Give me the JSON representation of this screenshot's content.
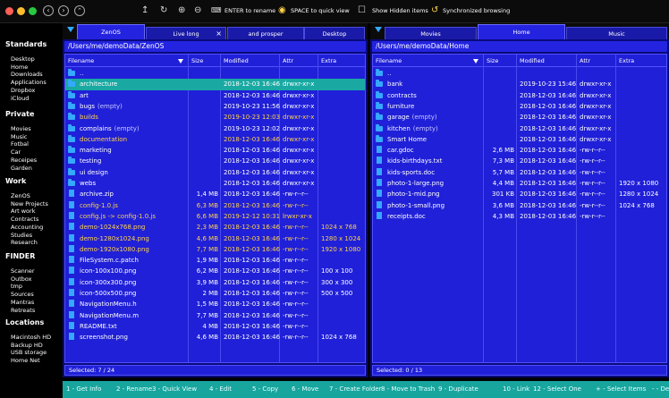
{
  "colors": {
    "accent": "#2323e0",
    "panel": "#2020d8",
    "selected": "#19a9a2",
    "highlight": "#ffd24a",
    "folder": "#35a8ff",
    "fkeybar": "#17a59e"
  },
  "toolbar": {
    "rename_hint": "ENTER to rename",
    "quickview_hint": "SPACE to quick view",
    "hidden_label": "Show Hidden items",
    "sync_label": "Synchronized browsing",
    "icons": [
      "back-icon",
      "forward-icon",
      "up-icon",
      "upload-icon",
      "refresh-icon",
      "add-icon",
      "remove-icon",
      "rename-icon",
      "eye-icon",
      "checkbox-icon",
      "sync-icon"
    ]
  },
  "sidebar": {
    "sections": [
      {
        "title": "Standards",
        "items": [
          "Desktop",
          "Home",
          "Downloads",
          "Applications",
          "Dropbox",
          "iCloud"
        ]
      },
      {
        "title": "Private",
        "items": [
          "Movies",
          "Music",
          "Fotbal",
          "Car",
          "Receipes",
          "Garden"
        ]
      },
      {
        "title": "Work",
        "items": [
          "ZenOS",
          "New Projects",
          "Art work",
          "Contracts",
          "Accounting",
          "Studies",
          "Research"
        ]
      },
      {
        "title": "FINDER",
        "items": [
          "Scanner",
          "Outbox",
          "tmp",
          "Sources",
          "Mantras",
          "Retreats"
        ]
      },
      {
        "title": "Locations",
        "items": [
          "Macintosh HD",
          "Backup HD",
          "USB storage",
          "Home Net"
        ]
      }
    ]
  },
  "left": {
    "tabs": [
      {
        "label": "ZenOS",
        "active": true
      },
      {
        "label": "Live long",
        "active": false,
        "closable": true
      },
      {
        "label": "and prosper",
        "active": false
      },
      {
        "label": "Desktop",
        "active": false
      }
    ],
    "path": "/Users/me/demoData/ZenOS",
    "columns": {
      "name": "Filename",
      "size": "Size",
      "modified": "Modified",
      "attr": "Attr",
      "extra": "Extra"
    },
    "status": "Selected: 7 / 24",
    "rows": [
      {
        "name": "..",
        "type": "folder",
        "size": "",
        "modified": "",
        "attr": "",
        "extra": ""
      },
      {
        "name": "architecture",
        "type": "folder",
        "size": "",
        "modified": "2018-12-03 16:46",
        "attr": "drwxr-xr-x",
        "extra": "",
        "selected": true
      },
      {
        "name": "art",
        "type": "folder",
        "size": "",
        "modified": "2018-12-03 16:46",
        "attr": "drwxr-xr-x",
        "extra": ""
      },
      {
        "name": "bugs",
        "suffix": "(empty)",
        "type": "folder",
        "size": "",
        "modified": "2019-10-23 11:56",
        "attr": "drwxr-xr-x",
        "extra": ""
      },
      {
        "name": "builds",
        "type": "folder",
        "size": "",
        "modified": "2019-10-23 12:03",
        "attr": "drwxr-xr-x",
        "extra": "",
        "marked": true
      },
      {
        "name": "complains",
        "suffix": "(empty)",
        "type": "folder",
        "size": "",
        "modified": "2019-10-23 12:02",
        "attr": "drwxr-xr-x",
        "extra": ""
      },
      {
        "name": "documentation",
        "type": "folder",
        "size": "",
        "modified": "2018-12-03 16:46",
        "attr": "drwxr-xr-x",
        "extra": "",
        "marked": true
      },
      {
        "name": "marketing",
        "type": "folder",
        "size": "",
        "modified": "2018-12-03 16:46",
        "attr": "drwxr-xr-x",
        "extra": ""
      },
      {
        "name": "testing",
        "type": "folder",
        "size": "",
        "modified": "2018-12-03 16:46",
        "attr": "drwxr-xr-x",
        "extra": ""
      },
      {
        "name": "ui design",
        "type": "folder",
        "size": "",
        "modified": "2018-12-03 16:46",
        "attr": "drwxr-xr-x",
        "extra": ""
      },
      {
        "name": "webs",
        "type": "folder",
        "size": "",
        "modified": "2018-12-03 16:46",
        "attr": "drwxr-xr-x",
        "extra": ""
      },
      {
        "name": "archive.zip",
        "type": "file",
        "size": "1,4 MB",
        "modified": "2018-12-03 16:46",
        "attr": "-rw-r--r--",
        "extra": ""
      },
      {
        "name": "config-1.0.js",
        "type": "file",
        "size": "6,3 MB",
        "modified": "2018-12-03 16:46",
        "attr": "-rw-r--r--",
        "extra": "",
        "marked": true
      },
      {
        "name": "config.js -> config-1.0.js",
        "type": "file",
        "size": "6,6 MB",
        "modified": "2019-12-12 10:31",
        "attr": "lrwxr-xr-x",
        "extra": "",
        "marked": true
      },
      {
        "name": "demo-1024x768.png",
        "type": "file",
        "size": "2,3 MB",
        "modified": "2018-12-03 16:46",
        "attr": "-rw-r--r--",
        "extra": "1024 x 768",
        "marked": true
      },
      {
        "name": "demo-1280x1024.png",
        "type": "file",
        "size": "4,6 MB",
        "modified": "2018-12-03 16:46",
        "attr": "-rw-r--r--",
        "extra": "1280 x 1024",
        "marked": true
      },
      {
        "name": "demo-1920x1080.png",
        "type": "file",
        "size": "7,7 MB",
        "modified": "2018-12-03 16:46",
        "attr": "-rw-r--r--",
        "extra": "1920 x 1080",
        "marked": true
      },
      {
        "name": "FileSystem.c.patch",
        "type": "file",
        "size": "1,9 MB",
        "modified": "2018-12-03 16:46",
        "attr": "-rw-r--r--",
        "extra": ""
      },
      {
        "name": "icon-100x100.png",
        "type": "file",
        "size": "6,2 MB",
        "modified": "2018-12-03 16:46",
        "attr": "-rw-r--r--",
        "extra": "100 x 100"
      },
      {
        "name": "icon-300x300.png",
        "type": "file",
        "size": "3,9 MB",
        "modified": "2018-12-03 16:46",
        "attr": "-rw-r--r--",
        "extra": "300 x 300"
      },
      {
        "name": "icon-500x500.png",
        "type": "file",
        "size": "2 MB",
        "modified": "2018-12-03 16:46",
        "attr": "-rw-r--r--",
        "extra": "500 x 500"
      },
      {
        "name": "NavigationMenu.h",
        "type": "file",
        "size": "1,5 MB",
        "modified": "2018-12-03 16:46",
        "attr": "-rw-r--r--",
        "extra": ""
      },
      {
        "name": "NavigationMenu.m",
        "type": "file",
        "size": "7,7 MB",
        "modified": "2018-12-03 16:46",
        "attr": "-rw-r--r--",
        "extra": ""
      },
      {
        "name": "README.txt",
        "type": "file",
        "size": "4 MB",
        "modified": "2018-12-03 16:46",
        "attr": "-rw-r--r--",
        "extra": ""
      },
      {
        "name": "screenshot.png",
        "type": "file",
        "size": "4,6 MB",
        "modified": "2018-12-03 16:46",
        "attr": "-rw-r--r--",
        "extra": "1024 x 768"
      }
    ]
  },
  "right": {
    "tabs": [
      {
        "label": "Movies",
        "active": false
      },
      {
        "label": "Home",
        "active": true
      },
      {
        "label": "Music",
        "active": false
      }
    ],
    "path": "/Users/me/demoData/Home",
    "columns": {
      "name": "Filename",
      "size": "Size",
      "modified": "Modified",
      "attr": "Attr",
      "extra": "Extra"
    },
    "status": "Selected: 0 / 13",
    "rows": [
      {
        "name": "..",
        "type": "folder",
        "size": "",
        "modified": "",
        "attr": "",
        "extra": ""
      },
      {
        "name": "bank",
        "type": "folder",
        "size": "",
        "modified": "2019-10-23 15:46",
        "attr": "drwxr-xr-x",
        "extra": ""
      },
      {
        "name": "contracts",
        "type": "folder",
        "size": "",
        "modified": "2018-12-03 16:46",
        "attr": "drwxr-xr-x",
        "extra": ""
      },
      {
        "name": "furniture",
        "type": "folder",
        "size": "",
        "modified": "2018-12-03 16:46",
        "attr": "drwxr-xr-x",
        "extra": ""
      },
      {
        "name": "garage",
        "suffix": "(empty)",
        "type": "folder",
        "size": "",
        "modified": "2018-12-03 16:46",
        "attr": "drwxr-xr-x",
        "extra": ""
      },
      {
        "name": "kitchen",
        "suffix": "(empty)",
        "type": "folder",
        "size": "",
        "modified": "2018-12-03 16:46",
        "attr": "drwxr-xr-x",
        "extra": ""
      },
      {
        "name": "Smart Home",
        "type": "folder",
        "size": "",
        "modified": "2018-12-03 16:46",
        "attr": "drwxr-xr-x",
        "extra": ""
      },
      {
        "name": "car.gdoc",
        "type": "file",
        "size": "2,6 MB",
        "modified": "2018-12-03 16:46",
        "attr": "-rw-r--r--",
        "extra": ""
      },
      {
        "name": "kids-birthdays.txt",
        "type": "file",
        "size": "7,3 MB",
        "modified": "2018-12-03 16:46",
        "attr": "-rw-r--r--",
        "extra": ""
      },
      {
        "name": "kids-sports.doc",
        "type": "file",
        "size": "5,7 MB",
        "modified": "2018-12-03 16:46",
        "attr": "-rw-r--r--",
        "extra": ""
      },
      {
        "name": "photo-1-large.png",
        "type": "file",
        "size": "4,4 MB",
        "modified": "2018-12-03 16:46",
        "attr": "-rw-r--r--",
        "extra": "1920 x 1080"
      },
      {
        "name": "photo-1-mid.png",
        "type": "file",
        "size": "301 KB",
        "modified": "2018-12-03 16:46",
        "attr": "-rw-r--r--",
        "extra": "1280 x 1024"
      },
      {
        "name": "photo-1-small.png",
        "type": "file",
        "size": "3,6 MB",
        "modified": "2018-12-03 16:46",
        "attr": "-rw-r--r--",
        "extra": "1024 x 768"
      },
      {
        "name": "receipts.doc",
        "type": "file",
        "size": "4,3 MB",
        "modified": "2018-12-03 16:46",
        "attr": "-rw-r--r--",
        "extra": ""
      }
    ]
  },
  "fkeys": [
    "1 - Get Info",
    "2 - Rename",
    "3 - Quick View",
    "4 - Edit",
    "5 - Copy",
    "6 - Move",
    "7 - Create Folder",
    "8 - Move to Trash",
    "9 - Duplicate",
    "10 - Link",
    "12 - Select One",
    "+ - Select Items",
    "- - De"
  ]
}
